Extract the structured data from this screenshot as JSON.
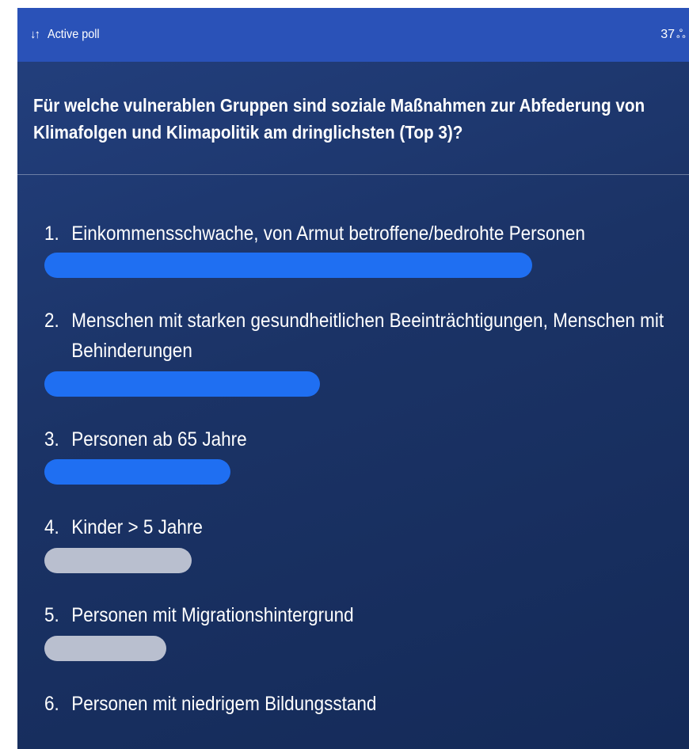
{
  "header": {
    "sort_icon": "↓↑",
    "title": "Active poll",
    "count": "37",
    "people_icon": "ஃ"
  },
  "question": {
    "line1": "Für welche vulnerablen Gruppen sind soziale Maßnahmen zur Abfederung von",
    "line2": "Klimafolgen und Klimapolitik am dringlichsten (Top 3)?"
  },
  "options": [
    {
      "number": "1.",
      "line1": "Einkommensschwache, von Armut betroffene/bedrohte Personen",
      "line2": "",
      "fill": 0.76,
      "highlighted": true
    },
    {
      "number": "2.",
      "line1": "Menschen mit starken gesundheitlichen Beeinträchtigungen, Menschen mit",
      "line2": "Behinderungen",
      "fill": 0.43,
      "highlighted": true
    },
    {
      "number": "3.",
      "line1": "Personen ab 65 Jahre",
      "line2": "",
      "fill": 0.29,
      "highlighted": true
    },
    {
      "number": "4.",
      "line1": "Kinder > 5 Jahre",
      "line2": "",
      "fill": 0.23,
      "highlighted": false
    },
    {
      "number": "5.",
      "line1": "Personen mit Migrationshintergrund",
      "line2": "",
      "fill": 0.19,
      "highlighted": false
    },
    {
      "number": "6.",
      "line1": "Personen mit niedrigem Bildungsstand",
      "line2": "",
      "fill": null,
      "highlighted": false
    }
  ],
  "colors": {
    "header_bg": "#2a52b8",
    "panel_bg": "#1b3366",
    "bar_top": "#1f6ff2",
    "bar_rest": "#b9bfcf"
  }
}
